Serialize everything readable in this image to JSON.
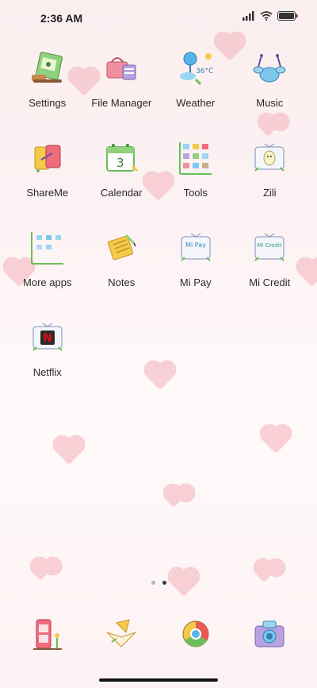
{
  "status_bar": {
    "time": "2:36 AM",
    "icons": [
      "signal-icon",
      "wifi-icon",
      "battery-icon"
    ]
  },
  "apps": [
    {
      "label": "Settings",
      "icon": "settings-icon"
    },
    {
      "label": "File Manager",
      "icon": "file-manager-icon"
    },
    {
      "label": "Weather",
      "icon": "weather-icon",
      "temperature": "36°C"
    },
    {
      "label": "Music",
      "icon": "music-icon"
    },
    {
      "label": "ShareMe",
      "icon": "shareme-icon"
    },
    {
      "label": "Calendar",
      "icon": "calendar-icon",
      "day": "3"
    },
    {
      "label": "Tools",
      "icon": "tools-folder-icon"
    },
    {
      "label": "Zili",
      "icon": "zili-icon"
    },
    {
      "label": "More apps",
      "icon": "more-apps-folder-icon"
    },
    {
      "label": "Notes",
      "icon": "notes-icon"
    },
    {
      "label": "Mi Pay",
      "icon": "mi-pay-icon",
      "icon_text": "Mi Pay"
    },
    {
      "label": "Mi Credit",
      "icon": "mi-credit-icon",
      "icon_text": "Mi Credit"
    },
    {
      "label": "Netflix",
      "icon": "netflix-icon",
      "icon_text": "N"
    }
  ],
  "page_indicator": {
    "count": 2,
    "active": 1
  },
  "dock": [
    {
      "icon": "phone-booth-icon"
    },
    {
      "icon": "messages-envelope-icon"
    },
    {
      "icon": "chrome-icon"
    },
    {
      "icon": "camera-icon"
    }
  ],
  "colors": {
    "heart": "#f7c9cf",
    "accent_green": "#6bbf59",
    "text": "#2a2a2a"
  }
}
